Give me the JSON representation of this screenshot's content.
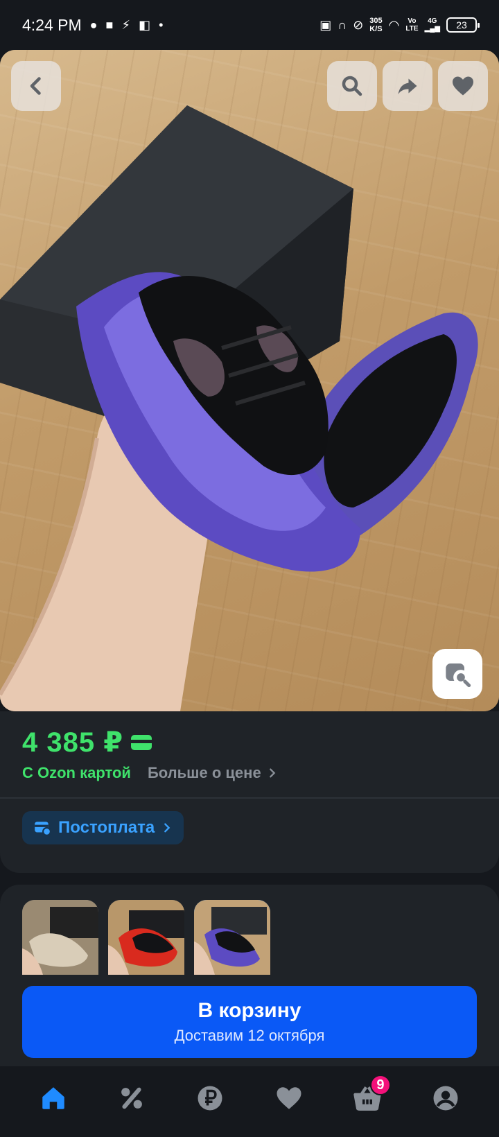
{
  "status_bar": {
    "time": "4:24 PM",
    "net_speed_value": "305",
    "net_speed_unit": "K/S",
    "volte_top": "Vo",
    "volte_bottom": "LTE",
    "network": "4G",
    "battery": "23"
  },
  "product": {
    "price": "4 385 ₽",
    "ozon_card_label": "С Ozon картой",
    "more_price_link": "Больше о цене",
    "postpay_label": "Постоплата"
  },
  "variants": [
    {
      "color": "beige",
      "selected": false
    },
    {
      "color": "red",
      "selected": false
    },
    {
      "color": "purple",
      "selected": true
    }
  ],
  "cart": {
    "button_label": "В корзину",
    "delivery_text": "Доставим 12 октября"
  },
  "tab_bar": {
    "items": [
      {
        "icon": "home-icon",
        "active": true
      },
      {
        "icon": "discount-icon",
        "active": false
      },
      {
        "icon": "ruble-icon",
        "active": false
      },
      {
        "icon": "heart-icon",
        "active": false
      },
      {
        "icon": "basket-icon",
        "active": false,
        "badge": "9"
      },
      {
        "icon": "profile-icon",
        "active": false
      }
    ]
  },
  "colors": {
    "accent_green": "#3fe26b",
    "accent_blue": "#0a59f6",
    "link_blue": "#3aa2ff",
    "badge_pink": "#f4117a",
    "background": "#15181d",
    "card": "#1f2328"
  }
}
